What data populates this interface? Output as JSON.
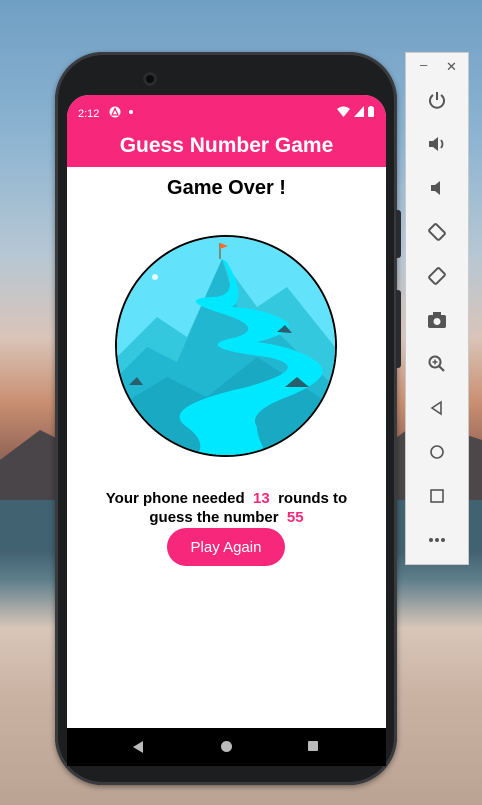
{
  "status_bar": {
    "time": "2:12"
  },
  "app": {
    "title": "Guess Number Game"
  },
  "screen": {
    "heading": "Game Over !",
    "summary_prefix": "Your phone needed",
    "rounds": "13",
    "summary_middle": "rounds to guess the number",
    "number": "55",
    "play_again_label": "Play Again"
  },
  "colors": {
    "accent": "#f7287b"
  },
  "emulator_toolbar": {
    "items": [
      "power-icon",
      "volume-up-icon",
      "volume-down-icon",
      "rotate-left-icon",
      "rotate-right-icon",
      "camera-icon",
      "zoom-icon",
      "back-icon",
      "home-icon",
      "overview-icon",
      "more-icon"
    ]
  }
}
